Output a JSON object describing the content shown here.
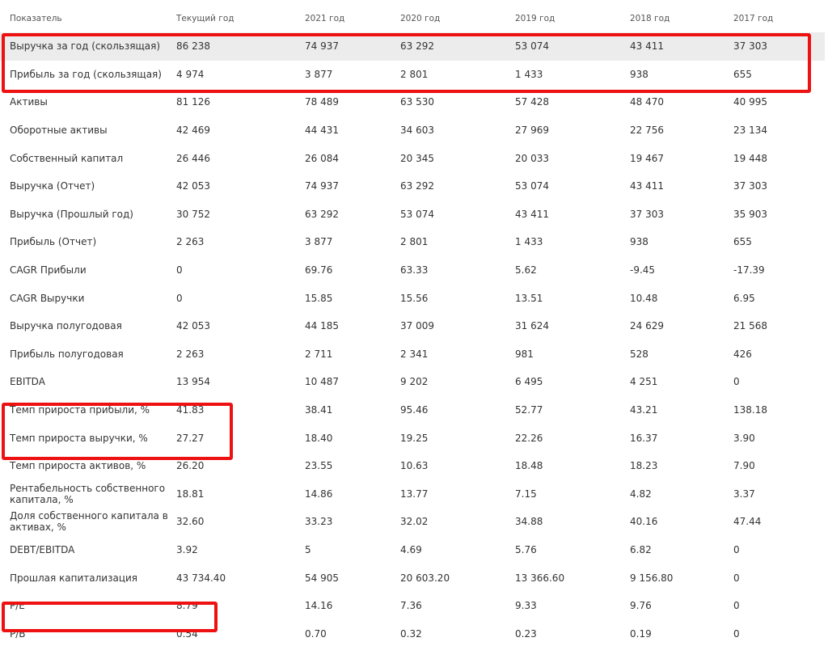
{
  "table": {
    "headers": [
      "Показатель",
      "Текущий год",
      "2021 год",
      "2020 год",
      "2019 год",
      "2018 год",
      "2017 год"
    ],
    "rows": [
      {
        "label": "Выручка за год (скользящая)",
        "values": [
          "86 238",
          "74 937",
          "63 292",
          "53 074",
          "43 411",
          "37 303"
        ]
      },
      {
        "label": "Прибыль за год (скользящая)",
        "values": [
          "4 974",
          "3 877",
          "2 801",
          "1 433",
          "938",
          "655"
        ]
      },
      {
        "label": "Активы",
        "values": [
          "81 126",
          "78 489",
          "63 530",
          "57 428",
          "48 470",
          "40 995"
        ]
      },
      {
        "label": "Оборотные активы",
        "values": [
          "42 469",
          "44 431",
          "34 603",
          "27 969",
          "22 756",
          "23 134"
        ]
      },
      {
        "label": "Собственный капитал",
        "values": [
          "26 446",
          "26 084",
          "20 345",
          "20 033",
          "19 467",
          "19 448"
        ]
      },
      {
        "label": "Выручка (Отчет)",
        "values": [
          "42 053",
          "74 937",
          "63 292",
          "53 074",
          "43 411",
          "37 303"
        ]
      },
      {
        "label": "Выручка (Прошлый год)",
        "values": [
          "30 752",
          "63 292",
          "53 074",
          "43 411",
          "37 303",
          "35 903"
        ]
      },
      {
        "label": "Прибыль (Отчет)",
        "values": [
          "2 263",
          "3 877",
          "2 801",
          "1 433",
          "938",
          "655"
        ]
      },
      {
        "label": "CAGR Прибыли",
        "values": [
          "0",
          "69.76",
          "63.33",
          "5.62",
          "-9.45",
          "-17.39"
        ]
      },
      {
        "label": "CAGR Выручки",
        "values": [
          "0",
          "15.85",
          "15.56",
          "13.51",
          "10.48",
          "6.95"
        ]
      },
      {
        "label": "Выручка полугодовая",
        "values": [
          "42 053",
          "44 185",
          "37 009",
          "31 624",
          "24 629",
          "21 568"
        ]
      },
      {
        "label": "Прибыль полугодовая",
        "values": [
          "2 263",
          "2 711",
          "2 341",
          "981",
          "528",
          "426"
        ]
      },
      {
        "label": "EBITDA",
        "values": [
          "13 954",
          "10 487",
          "9 202",
          "6 495",
          "4 251",
          "0"
        ]
      },
      {
        "label": "Темп прироста прибыли, %",
        "values": [
          "41.83",
          "38.41",
          "95.46",
          "52.77",
          "43.21",
          "138.18"
        ]
      },
      {
        "label": "Темп прироста выручки, %",
        "values": [
          "27.27",
          "18.40",
          "19.25",
          "22.26",
          "16.37",
          "3.90"
        ]
      },
      {
        "label": "Темп прироста активов, %",
        "values": [
          "26.20",
          "23.55",
          "10.63",
          "18.48",
          "18.23",
          "7.90"
        ]
      },
      {
        "label": "Рентабельность собственного капитала, %",
        "values": [
          "18.81",
          "14.86",
          "13.77",
          "7.15",
          "4.82",
          "3.37"
        ]
      },
      {
        "label": "Доля собственного капитала в активах, %",
        "values": [
          "32.60",
          "33.23",
          "32.02",
          "34.88",
          "40.16",
          "47.44"
        ]
      },
      {
        "label": "DEBT/EBITDA",
        "values": [
          "3.92",
          "5",
          "4.69",
          "5.76",
          "6.82",
          "0"
        ]
      },
      {
        "label": "Прошлая капитализация",
        "values": [
          "43 734.40",
          "54 905",
          "20 603.20",
          "13 366.60",
          "9 156.80",
          "0"
        ]
      },
      {
        "label": "P/E",
        "values": [
          "8.79",
          "14.16",
          "7.36",
          "9.33",
          "9.76",
          "0"
        ]
      },
      {
        "label": "P/B",
        "values": [
          "0.54",
          "0.70",
          "0.32",
          "0.23",
          "0.19",
          "0"
        ]
      }
    ]
  },
  "highlight_color": "#ee1111",
  "highlighted_rows": [
    [
      "Выручка за год (скользящая)",
      "Прибыль за год (скользящая)"
    ],
    [
      "Темп прироста прибыли, %",
      "Темп прироста выручки, %"
    ],
    [
      "P/E"
    ]
  ]
}
